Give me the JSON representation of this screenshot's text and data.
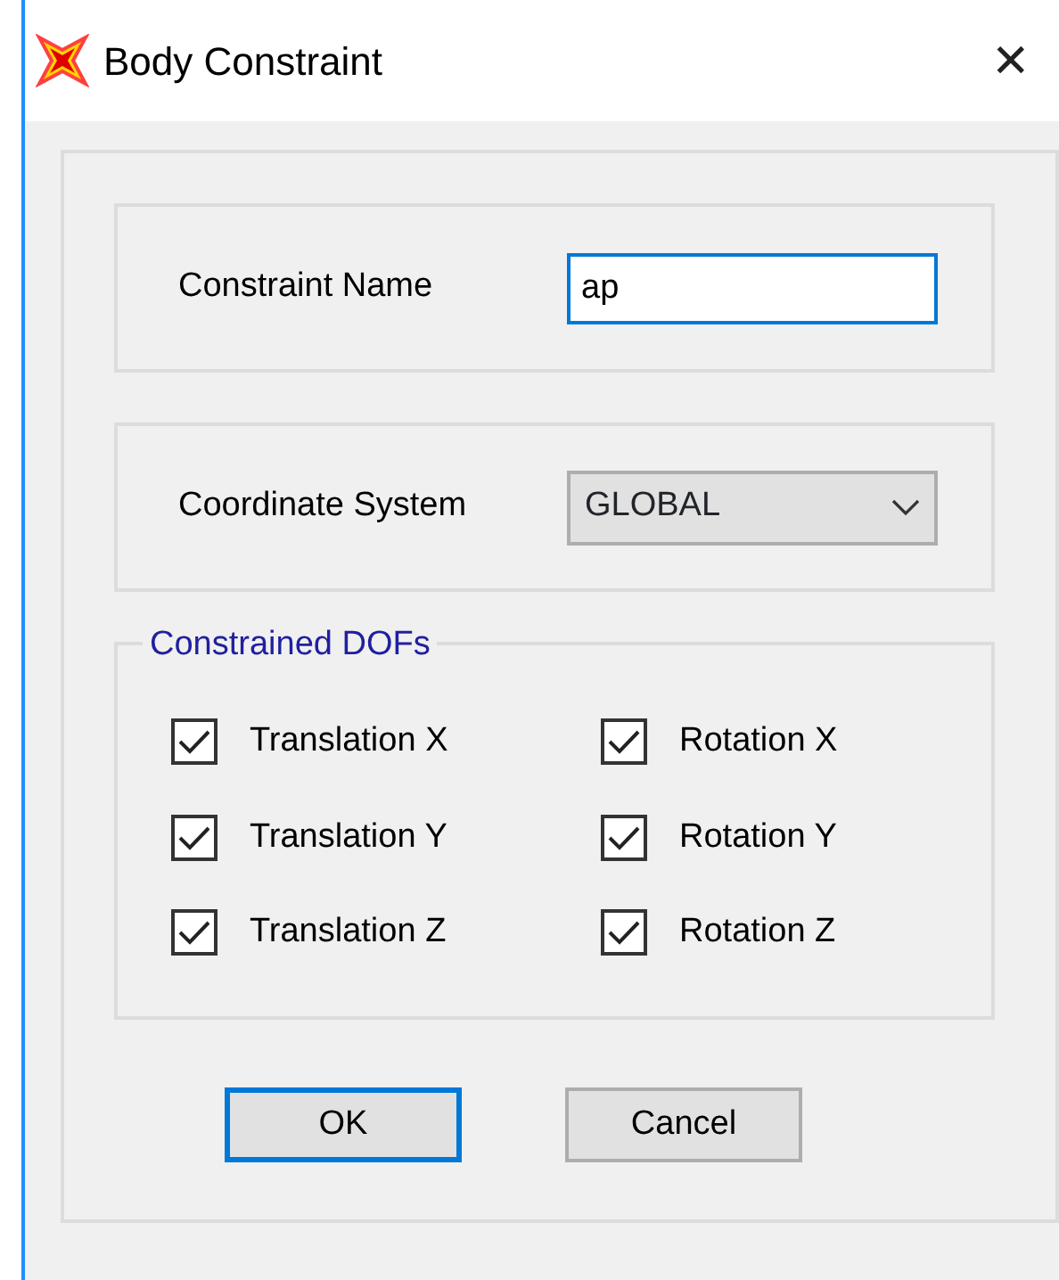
{
  "window": {
    "title": "Body Constraint",
    "close": "✕"
  },
  "constraint_name": {
    "label": "Constraint Name",
    "value": "ap",
    "focused": true
  },
  "coordinate_system": {
    "label": "Coordinate System",
    "value": "GLOBAL"
  },
  "dofs": {
    "title": "Constrained DOFs",
    "items": [
      {
        "label": "Translation X",
        "checked": true
      },
      {
        "label": "Rotation X",
        "checked": true
      },
      {
        "label": "Translation Y",
        "checked": true
      },
      {
        "label": "Rotation Y",
        "checked": true
      },
      {
        "label": "Translation Z",
        "checked": true
      },
      {
        "label": "Rotation Z",
        "checked": true
      }
    ]
  },
  "buttons": [
    {
      "label": "OK",
      "default": true
    },
    {
      "label": "Cancel",
      "default": false
    }
  ]
}
